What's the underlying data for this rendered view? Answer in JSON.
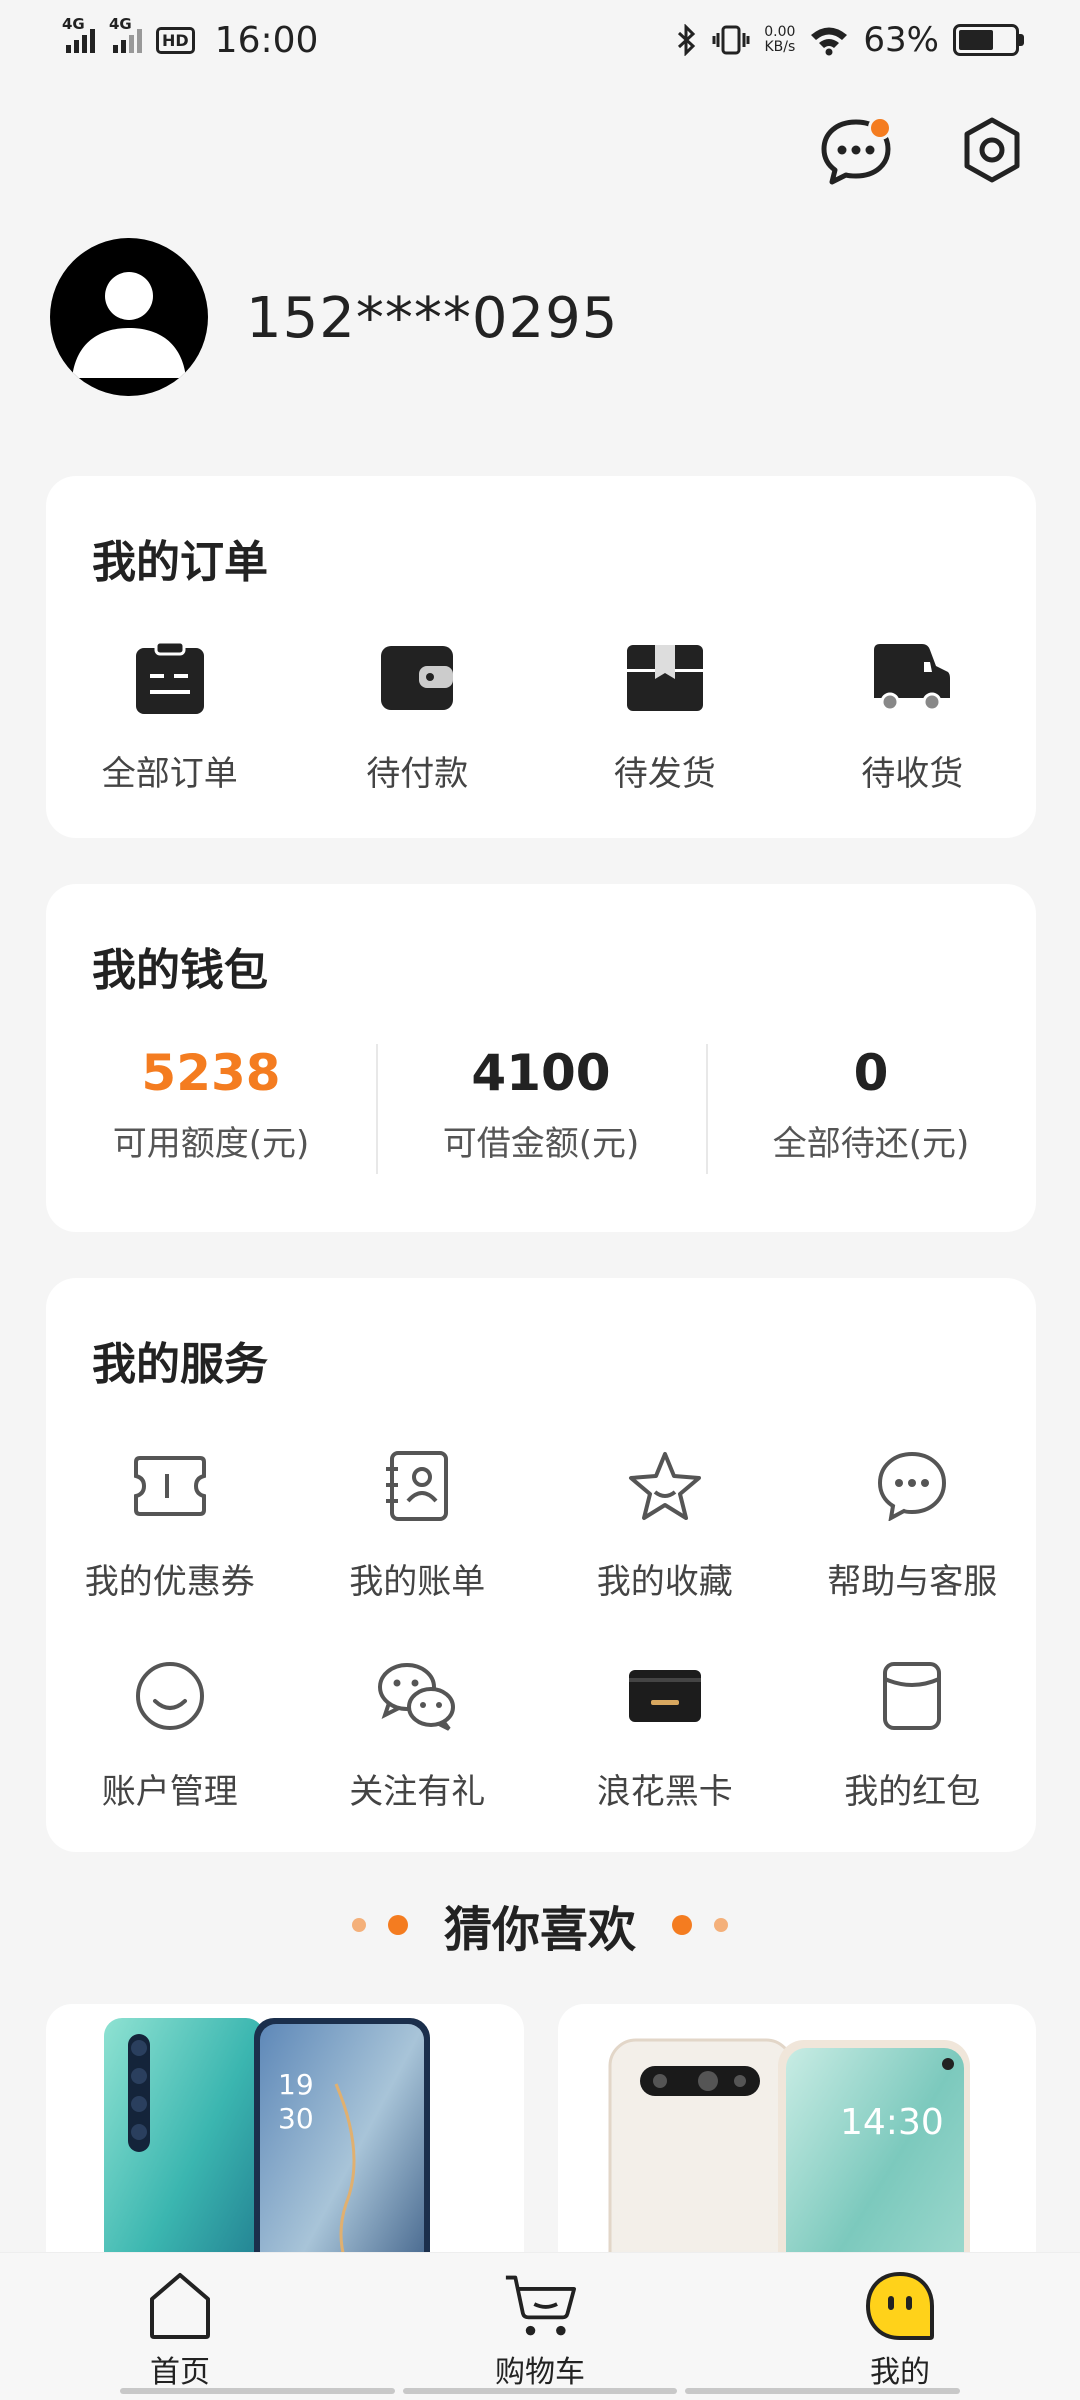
{
  "status_bar": {
    "net1": "4G",
    "net2": "4G",
    "hd": "HD",
    "time": "16:00",
    "speed_value": "0.00",
    "speed_unit": "KB/s",
    "battery": "63%"
  },
  "header_icons": {
    "message": "message-icon",
    "settings": "settings-icon"
  },
  "profile": {
    "phone": "152****0295",
    "avatar": "avatar-icon"
  },
  "orders": {
    "title": "我的订单",
    "items": [
      {
        "label": "全部订单",
        "icon": "clipboard-icon"
      },
      {
        "label": "待付款",
        "icon": "wallet-icon"
      },
      {
        "label": "待发货",
        "icon": "package-icon"
      },
      {
        "label": "待收货",
        "icon": "truck-icon"
      }
    ]
  },
  "wallet": {
    "title": "我的钱包",
    "items": [
      {
        "value": "5238",
        "label": "可用额度(元)"
      },
      {
        "value": "4100",
        "label": "可借金额(元)"
      },
      {
        "value": "0",
        "label": "全部待还(元)"
      }
    ]
  },
  "services": {
    "title": "我的服务",
    "items": [
      {
        "label": "我的优惠券",
        "icon": "coupon-icon"
      },
      {
        "label": "我的账单",
        "icon": "bill-icon"
      },
      {
        "label": "我的收藏",
        "icon": "star-icon"
      },
      {
        "label": "帮助与客服",
        "icon": "chat-icon"
      },
      {
        "label": "账户管理",
        "icon": "smile-icon"
      },
      {
        "label": "关注有礼",
        "icon": "wechat-icon"
      },
      {
        "label": "浪花黑卡",
        "icon": "black-card-icon"
      },
      {
        "label": "我的红包",
        "icon": "red-packet-icon"
      }
    ]
  },
  "recommend": {
    "title": "猜你喜欢"
  },
  "products": [
    {
      "screen_time_top": "19",
      "screen_time_bottom": "30"
    },
    {
      "screen_time": "14:30"
    }
  ],
  "bottom_nav": [
    {
      "label": "首页",
      "icon": "home-icon"
    },
    {
      "label": "购物车",
      "icon": "cart-icon"
    },
    {
      "label": "我的",
      "icon": "profile-face-icon"
    }
  ],
  "colors": {
    "accent": "#f47c20",
    "background": "#f5f5f5",
    "card": "#ffffff"
  }
}
